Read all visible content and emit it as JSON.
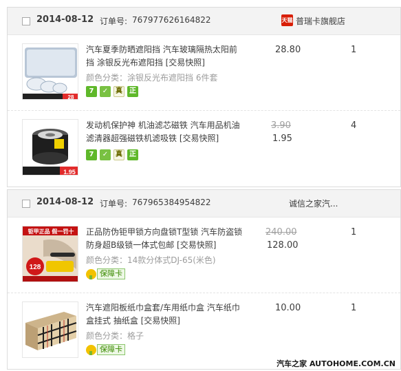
{
  "orders": [
    {
      "date": "2014-08-12",
      "order_label": "订单号:",
      "order_no": "767977626164822",
      "shop_name": "普瑞卡旗舰店",
      "shop_icon": "天猫",
      "items": [
        {
          "title": "汽车夏季防晒遮阳挡 汽车玻璃隔热太阳前挡 涂银反光布遮阳挡 [交易快照]",
          "sku": "颜色分类：涂银反光布遮阳挡 6件套",
          "price": "28.80",
          "qty": "1",
          "thumb_price": "28",
          "badges": [
            "7",
            "✓",
            "真",
            "正"
          ]
        },
        {
          "title": "发动机保护神 机油滤芯磁铁 汽车用品机油滤清器超强磁铁机滤吸铁 [交易快照]",
          "price_old": "3.90",
          "price_new": "1.95",
          "qty": "4",
          "thumb_price": "1.95",
          "badges": [
            "7",
            "✓",
            "真",
            "正"
          ]
        }
      ]
    },
    {
      "date": "2014-08-12",
      "order_label": "订单号:",
      "order_no": "767965384954822",
      "shop_name": "诚信之家汽...",
      "items": [
        {
          "title": "正品防伪钜甲锁方向盘锁T型锁 汽车防盗锁 防身超B级锁一体式包邮 [交易快照]",
          "sku": "颜色分类：14款分体式DJ-65(米色)",
          "price_old": "240.00",
          "price_new": "128.00",
          "qty": "1",
          "guarantee": "保障卡",
          "thumb_top": "钜甲正品 假一罚十",
          "thumb_price": "128"
        },
        {
          "title": "汽车遮阳板纸巾盒套/车用纸巾盒 汽车纸巾盒挂式 抽纸盒 [交易快照]",
          "sku": "颜色分类：格子",
          "price": "10.00",
          "qty": "1",
          "guarantee": "保障卡"
        }
      ]
    }
  ],
  "watermark": "汽车之家 AUTOHOME.COM.CN"
}
